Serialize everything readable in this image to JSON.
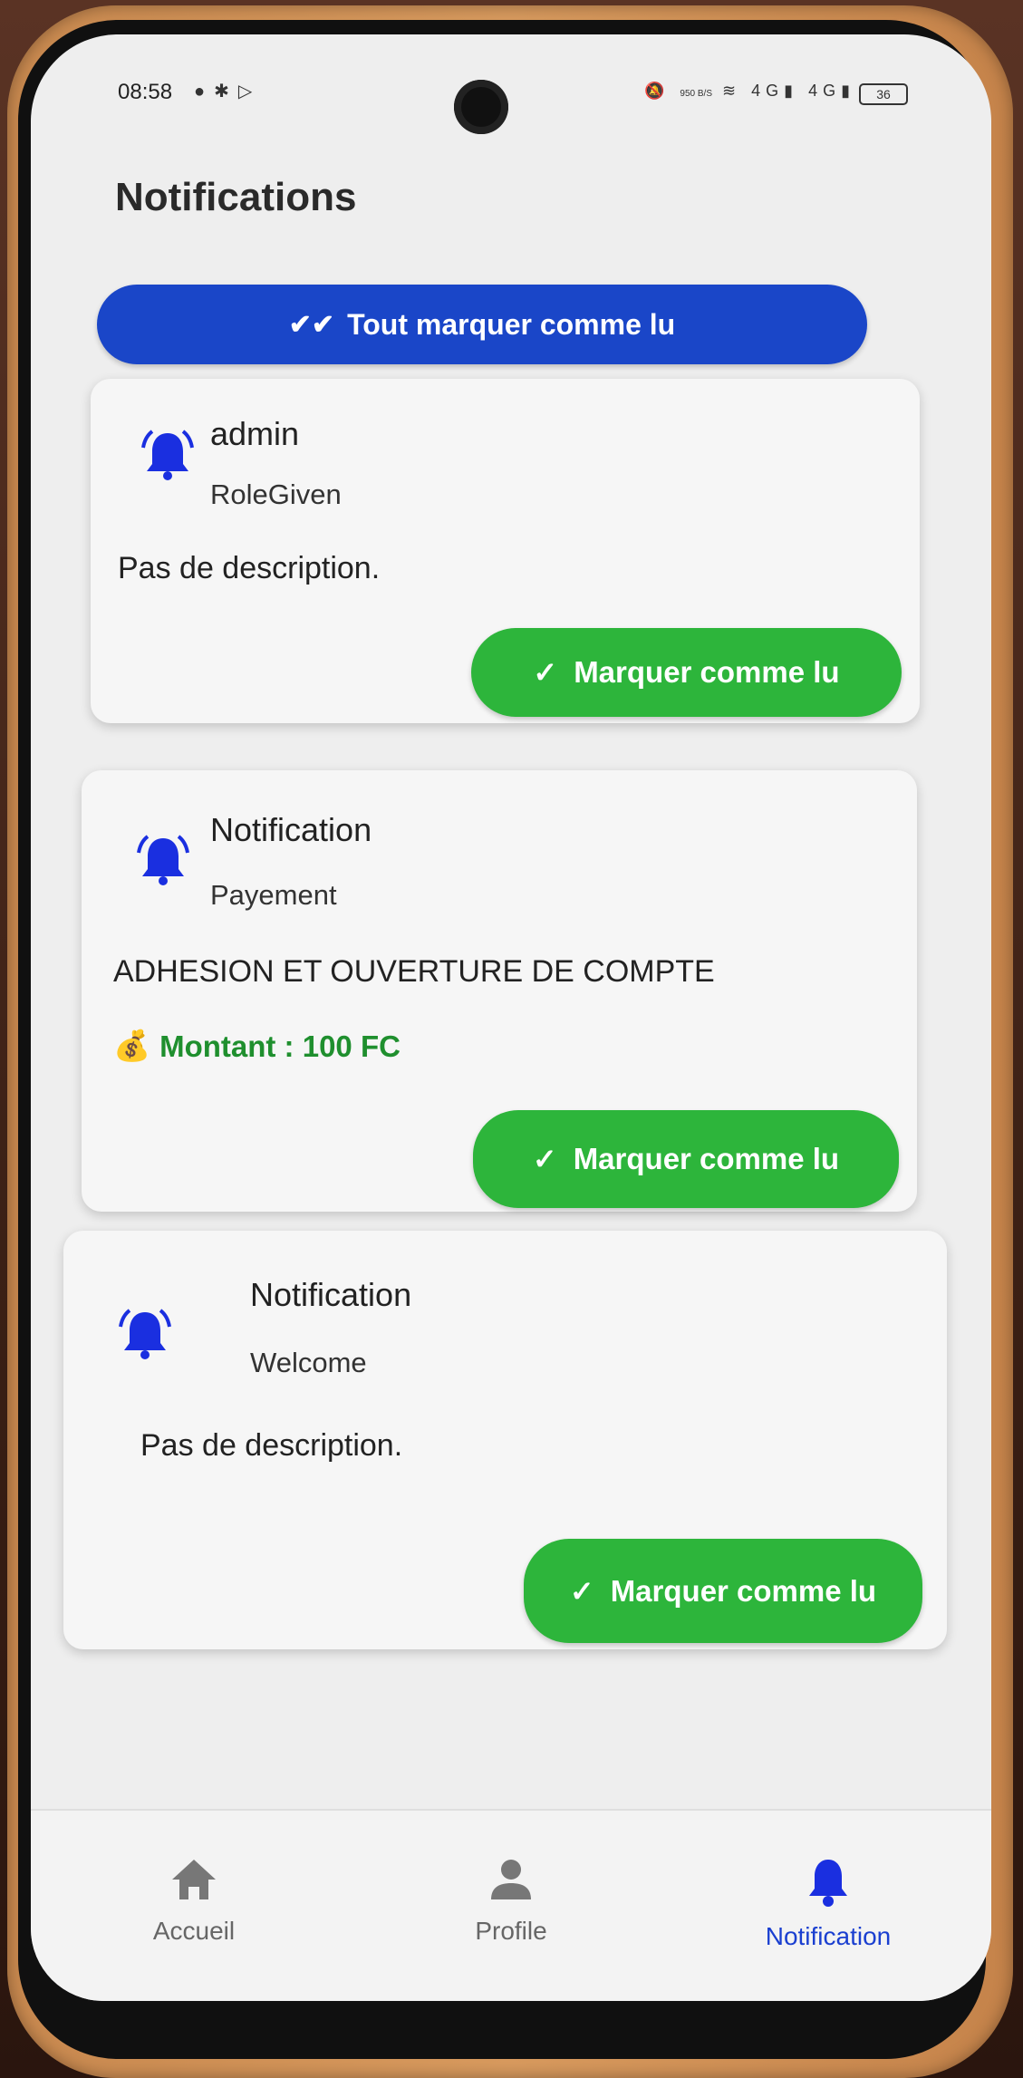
{
  "status_bar": {
    "time": "08:58",
    "left_icons": [
      "message-icon",
      "settings-icon",
      "play-icon"
    ],
    "right_icons": [
      "mute-icon",
      "data-speed",
      "wifi-icon",
      "signal-4g-icon",
      "signal-4g-icon"
    ],
    "data_speed": "950 B/S",
    "battery_level": "36"
  },
  "header": {
    "title": "Notifications"
  },
  "actions": {
    "mark_all_label": "Tout marquer comme lu"
  },
  "notifications": [
    {
      "title": "admin",
      "type": "RoleGiven",
      "description": "Pas de description.",
      "amount": null,
      "button_label": "Marquer comme lu"
    },
    {
      "title": "Notification",
      "type": "Payement",
      "description": "ADHESION ET OUVERTURE DE COMPTE",
      "amount": "Montant : 100 FC",
      "button_label": "Marquer comme lu"
    },
    {
      "title": "Notification",
      "type": "Welcome",
      "description": "Pas de description.",
      "amount": null,
      "button_label": "Marquer comme lu"
    }
  ],
  "bottom_nav": {
    "items": [
      {
        "label": "Accueil",
        "icon": "home-icon",
        "active": false
      },
      {
        "label": "Profile",
        "icon": "person-icon",
        "active": false
      },
      {
        "label": "Notification",
        "icon": "bell-icon",
        "active": true
      }
    ]
  },
  "colors": {
    "primary_blue": "#1a46c8",
    "success_green": "#2db53b",
    "amount_green": "#1f8f2e",
    "active_nav": "#1a3fd0"
  }
}
